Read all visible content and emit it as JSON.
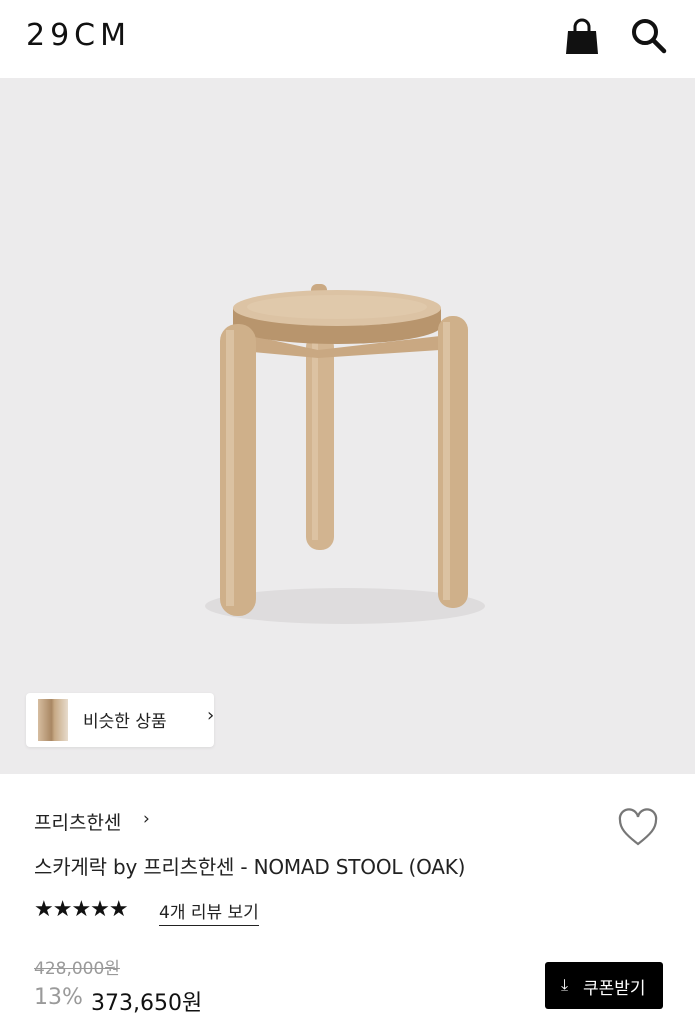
{
  "header": {
    "logo": "29CM",
    "icons": [
      "shopping-bag-icon",
      "search-icon"
    ]
  },
  "gallery": {
    "similar_label": "비슷한 상품",
    "similar_chevron": "›"
  },
  "product": {
    "brand": "프리츠한센",
    "brand_chevron": "›",
    "title": "스카게락 by 프리츠한센 - NOMAD STOOL (OAK)",
    "rating_stars": "★★★★★",
    "rating": 5,
    "review_link": "4개 리뷰 보기",
    "original_price": "428,000원",
    "discount_rate": "13%",
    "sale_price": "373,650원",
    "coupon_label": "쿠폰받기",
    "coupon_icon": "⤓"
  },
  "colors": {
    "background_image": "#ecebec",
    "wood": "#d9bd9c",
    "button": "#000000"
  }
}
